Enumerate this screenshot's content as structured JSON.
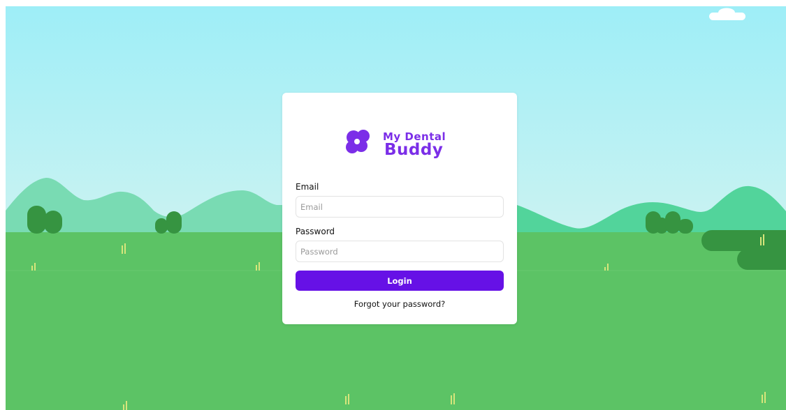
{
  "login": {
    "email_label": "Email",
    "email_placeholder": "Email",
    "email_value": "",
    "password_label": "Password",
    "password_placeholder": "Password",
    "password_value": "",
    "login_button": "Login",
    "forgot_password": "Forgot your password?"
  },
  "icons": {
    "logo": "my-dental-buddy-logo",
    "cloud": "cloud-icon",
    "bushes": "bush-icon",
    "grass": "grass-tuft-icon"
  },
  "colors": {
    "sky_top": "#9eeef7",
    "sky_bottom": "#c9f2f2",
    "hills_left": "#79dbb3",
    "hills_right": "#52d49b",
    "grass": "#5cc365",
    "bush": "#369441",
    "grass_tuft": "#d7e57b",
    "brand_purple": "#6611e6",
    "logo_purple": "#7b2ee8"
  },
  "logo_wordmark": {
    "line1": "My Dental",
    "line2": "Buddy"
  }
}
